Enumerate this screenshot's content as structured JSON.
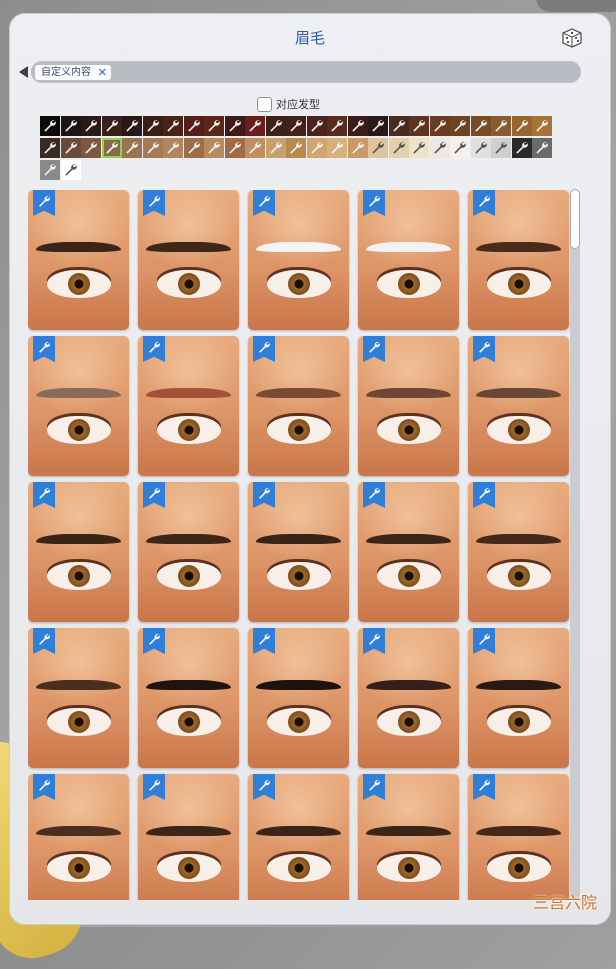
{
  "panel": {
    "title": "眉毛",
    "randomize_icon": "dice-icon",
    "back_icon": "back-arrow-icon"
  },
  "filter": {
    "chip_label": "自定义内容",
    "chip_remove_icon": "close-icon",
    "match_hair_label": "对应发型",
    "match_hair_checked": false
  },
  "colors": {
    "accent": "#2a5ea8",
    "badge": "#2f7fd8",
    "selected_outline": "#8fd14f"
  },
  "swatch_rows": [
    [
      "#0d0b0b",
      "#1c1513",
      "#2a1a16",
      "#3a201a",
      "#2a1816",
      "#3b1d18",
      "#4a2217",
      "#541f17",
      "#5d2718",
      "#3f1a16",
      "#6b1d1a",
      "#3c2117",
      "#43201a",
      "#4d231b",
      "#5a2b1c",
      "#3b1c1a",
      "#2a1916",
      "#4a2a1f",
      "#5e3322",
      "#6a3a22",
      "#6e4322",
      "#7a4b27",
      "#8a5a30",
      "#97652f",
      "#a77438"
    ],
    [
      "#3a2a26",
      "#6a4a3a",
      "#7d5943",
      "#8a6a4a",
      "#9a7450",
      "#a57a55",
      "#b08660",
      "#9c6f4b",
      "#b88b5e",
      "#a56a42",
      "#c08f60",
      "#c9a070",
      "#b98a50",
      "#d0a66e",
      "#d7b07a",
      "#c79a68",
      "#e1c49a",
      "#e5d0ae",
      "#f0e2c8",
      "#ece9e4",
      "#f4f1ec",
      "#e1dfdc",
      "#cfcfcf",
      "#2a2a2a",
      "#6a6a6a"
    ],
    [
      "#8a8a8a",
      "#ffffff"
    ]
  ],
  "selected_swatch": {
    "row": 1,
    "index": 3
  },
  "grid": {
    "rows": [
      [
        {
          "brow": "#3b2418"
        },
        {
          "brow": "#3e2618"
        },
        {
          "brow": "#f4f4f4"
        },
        {
          "brow": "#f2f2f2"
        },
        {
          "brow": "#4a2a1c"
        }
      ],
      [
        {
          "brow": "#8a6a5a"
        },
        {
          "brow": "#a5513a"
        },
        {
          "brow": "#7a4a34"
        },
        {
          "brow": "#6d4634"
        },
        {
          "brow": "#6a4634"
        }
      ],
      [
        {
          "brow": "#3a2418"
        },
        {
          "brow": "#3c2519"
        },
        {
          "brow": "#3a2318"
        },
        {
          "brow": "#3b2418"
        },
        {
          "brow": "#44291b"
        }
      ],
      [
        {
          "brow": "#4a2e20"
        },
        {
          "brow": "#1f1410"
        },
        {
          "brow": "#1c120e"
        },
        {
          "brow": "#342018"
        },
        {
          "brow": "#2a1a13"
        }
      ],
      [
        {
          "brow": "#4a2e20"
        },
        {
          "brow": "#3c2519"
        },
        {
          "brow": "#3a2318"
        },
        {
          "brow": "#3b2418"
        },
        {
          "brow": "#44291b"
        }
      ]
    ],
    "badge_icon": "wrench-icon"
  },
  "watermark": "三宫六院"
}
